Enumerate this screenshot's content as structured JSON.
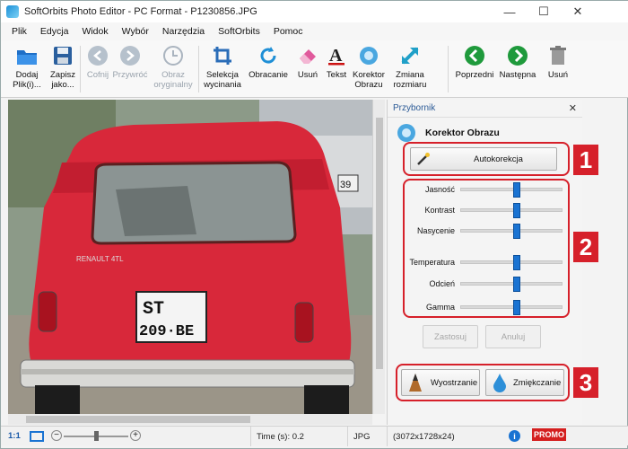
{
  "window": {
    "title": "SoftOrbits Photo Editor - PC Format - P1230856.JPG",
    "controls": [
      "—",
      "☐",
      "✕"
    ]
  },
  "menu": [
    "Plik",
    "Edycja",
    "Widok",
    "Wybór",
    "Narzędzia",
    "SoftOrbits",
    "Pomoc"
  ],
  "toolbar": {
    "add": "Dodaj Plik(i)...",
    "save": "Zapisz jako...",
    "undo": "Cofnij",
    "redo": "Przywróć",
    "original": "Obraz oryginalny",
    "crop": "Selekcja wycinania",
    "rotate": "Obracanie",
    "erase": "Usuń",
    "text": "Tekst",
    "corrector": "Korektor Obrazu",
    "resize": "Zmiana rozmiaru",
    "prev": "Poprzedni",
    "next": "Następna",
    "delete": "Usuń"
  },
  "panel": {
    "header": "Przybornik",
    "close": "✕",
    "title": "Korektor Obrazu",
    "auto_button": "Autokorekcja",
    "sliders": [
      {
        "label": "Jasność",
        "value": 0.55
      },
      {
        "label": "Kontrast",
        "value": 0.55
      },
      {
        "label": "Nasycenie",
        "value": 0.55
      },
      {
        "label": "Temperatura",
        "value": 0.55
      },
      {
        "label": "Odcień",
        "value": 0.55
      },
      {
        "label": "Gamma",
        "value": 0.55
      }
    ],
    "apply_button": "Zastosuj",
    "cancel_button": "Anuluj",
    "sharpen_button": "Wyostrzanie",
    "soften_button": "Zmiękczanie",
    "callouts": [
      "1",
      "2",
      "3"
    ]
  },
  "photo": {
    "plate_line1": "ST",
    "plate_line2": "209·BE",
    "badge": "RENAULT 4TL",
    "side_plate": "39"
  },
  "status": {
    "zoom": "1:1",
    "time": "Time (s): 0.2",
    "format": "JPG",
    "dims": "(3072x1728x24)",
    "promo": "PROMO"
  },
  "colors": {
    "callout": "#d6202a",
    "slider_thumb": "#1a73d2",
    "car": "#d8283a"
  }
}
